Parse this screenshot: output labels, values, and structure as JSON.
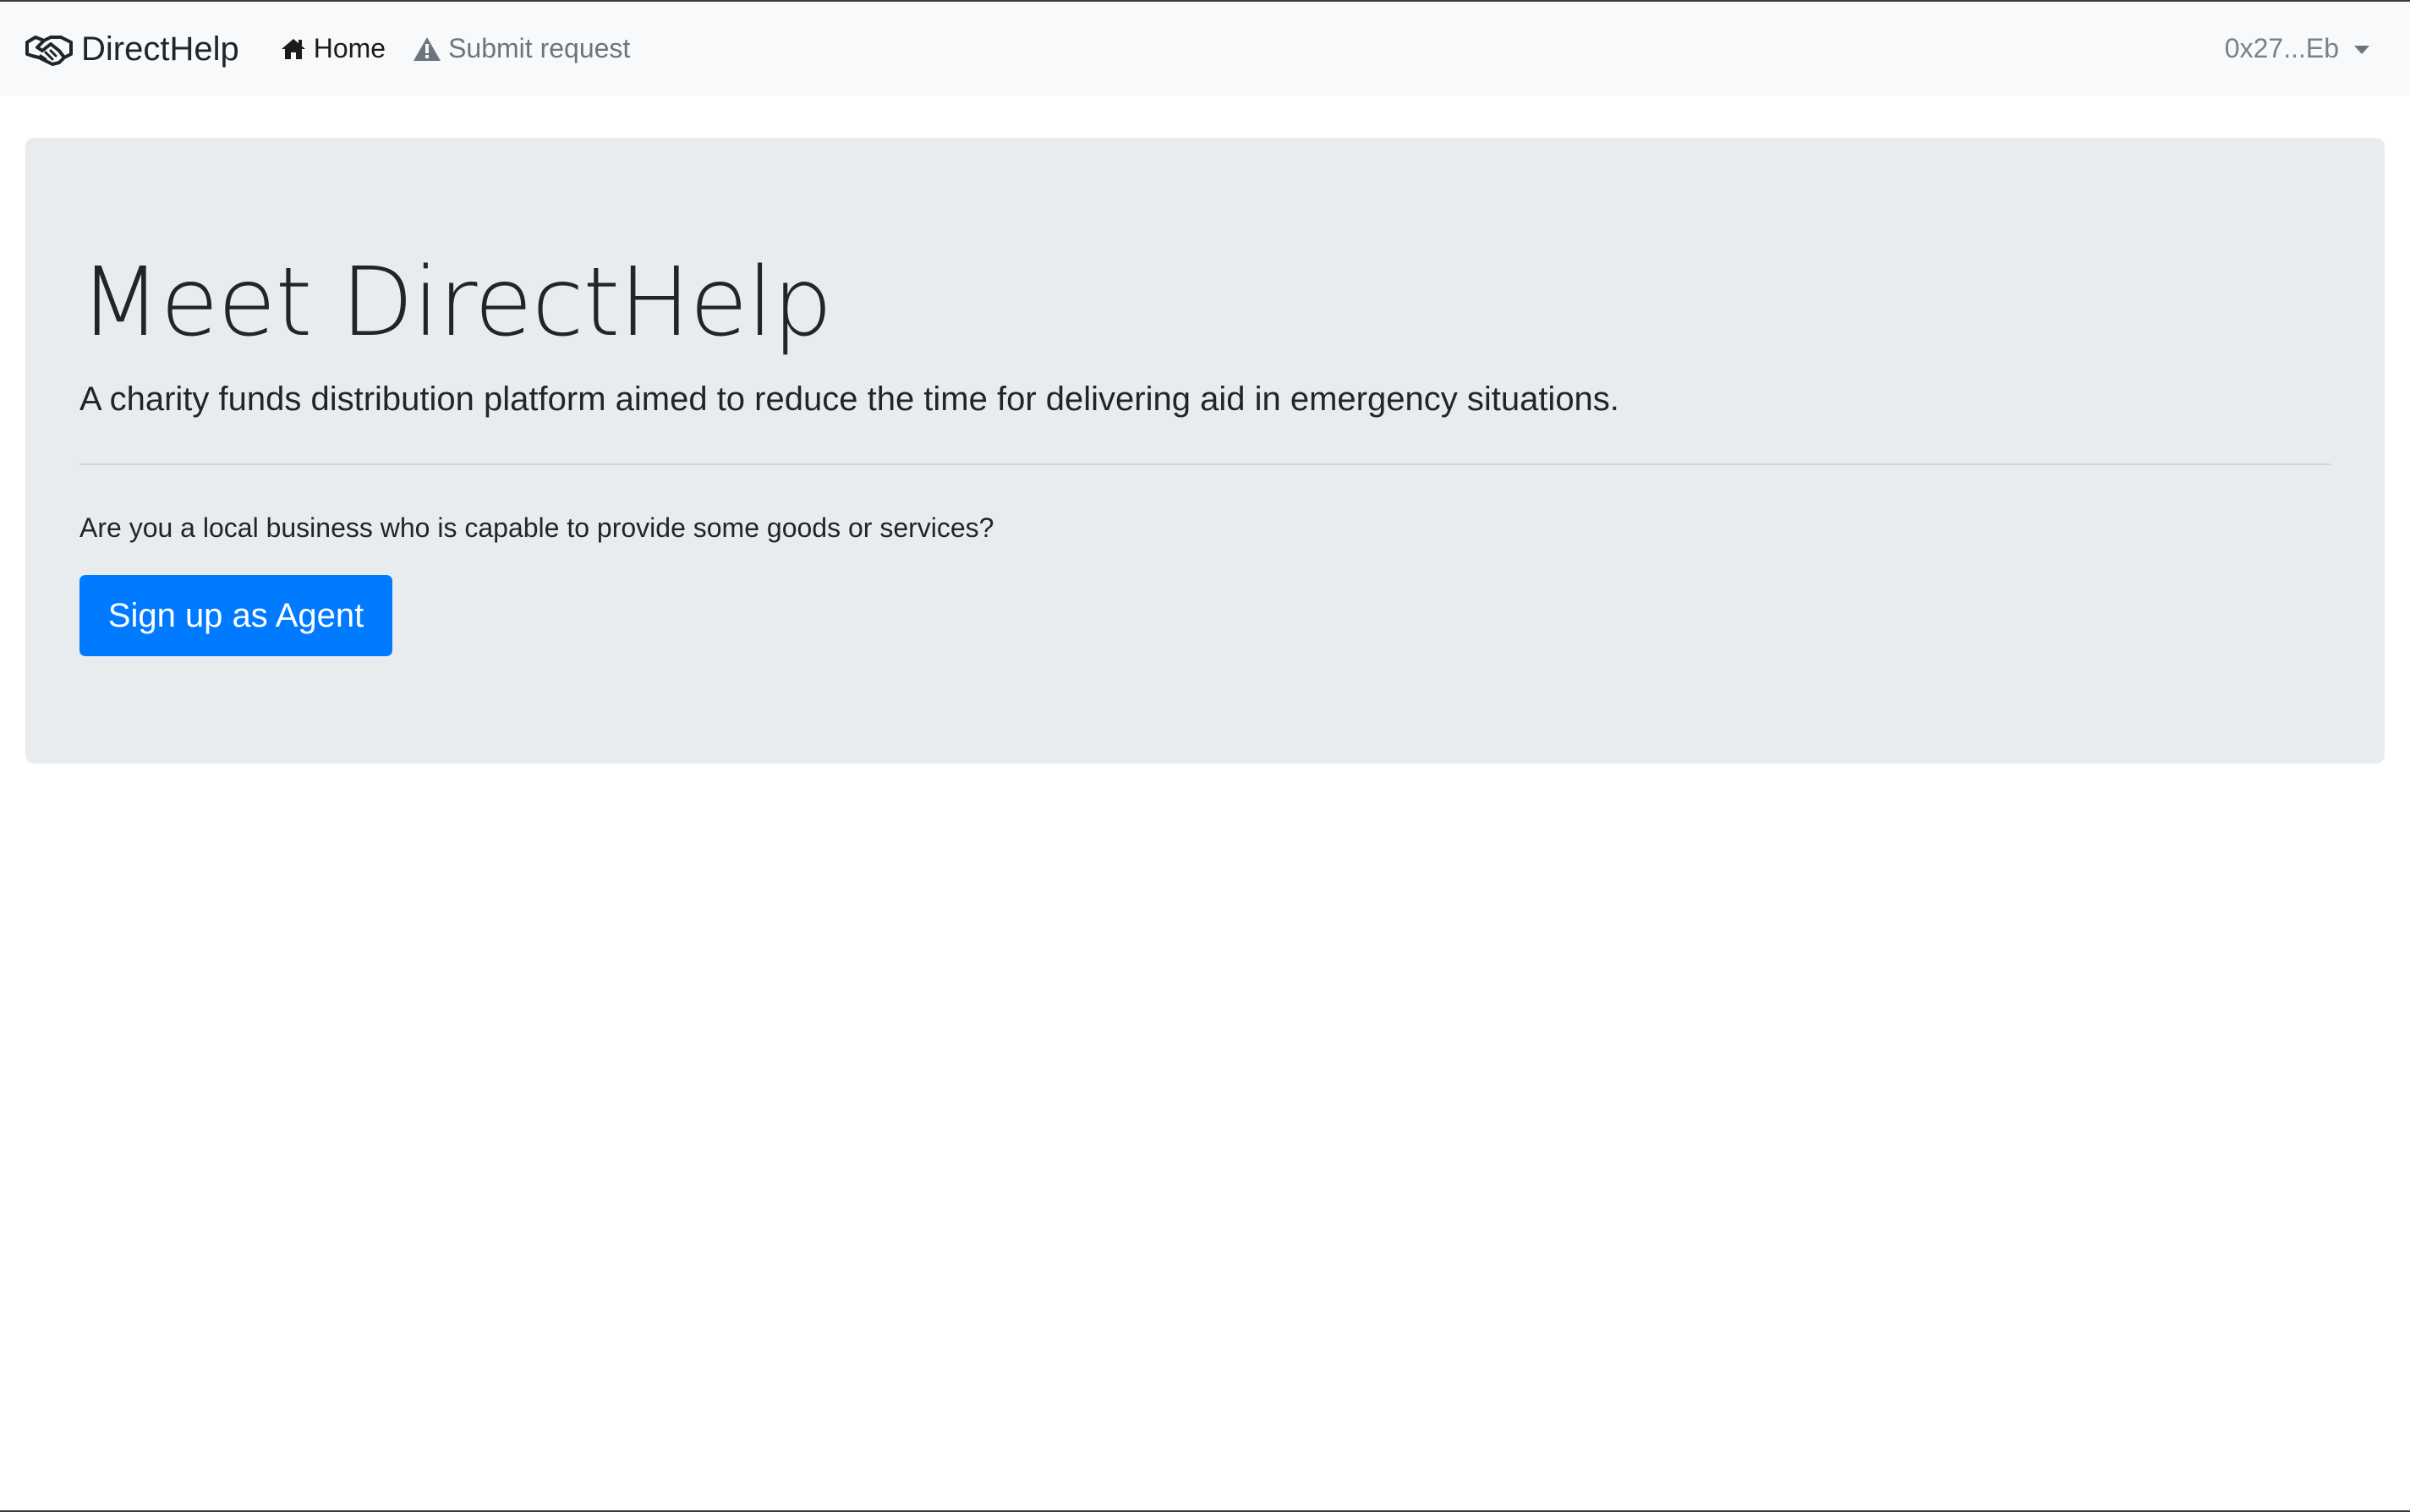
{
  "navbar": {
    "brand": {
      "icon": "handshake-icon",
      "label": "DirectHelp"
    },
    "links": [
      {
        "icon": "home-icon",
        "label": "Home",
        "active": true
      },
      {
        "icon": "warning-icon",
        "label": "Submit request",
        "active": false
      }
    ],
    "account": {
      "label": "0x27...Eb",
      "icon": "caret-down-icon"
    }
  },
  "hero": {
    "title": "Meet DirectHelp",
    "lead": "A charity funds distribution platform aimed to reduce the time for delivering aid in emergency situations.",
    "question": "Are you a local business who is capable to provide some goods or services?",
    "button_label": "Sign up as Agent"
  },
  "colors": {
    "navbar_bg": "#f8f9fa",
    "jumbotron_bg": "#e9ecef",
    "primary": "#007bff",
    "text": "#212529",
    "muted": "#6c757d"
  }
}
